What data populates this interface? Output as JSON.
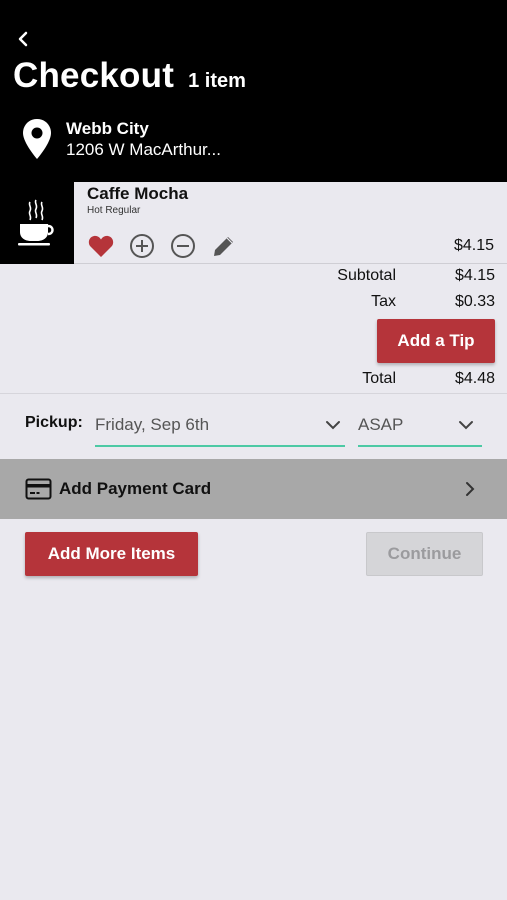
{
  "header": {
    "title": "Checkout",
    "item_count": "1 item",
    "location": {
      "city": "Webb City",
      "address": "1206 W MacArthur..."
    }
  },
  "cart": {
    "items": [
      {
        "name": "Caffe Mocha",
        "modifiers": "Hot Regular",
        "price": "$4.15",
        "icons": [
          "coffee-cup-icon",
          "heart-icon",
          "plus-circle-icon",
          "minus-circle-icon",
          "pencil-icon"
        ]
      }
    ]
  },
  "totals": {
    "subtotal_label": "Subtotal",
    "subtotal_value": "$4.15",
    "tax_label": "Tax",
    "tax_value": "$0.33",
    "tip_button": "Add a Tip",
    "total_label": "Total",
    "total_value": "$4.48"
  },
  "pickup": {
    "label": "Pickup:",
    "date": "Friday, Sep 6th",
    "time": "ASAP"
  },
  "payment": {
    "label": "Add Payment Card",
    "icon": "credit-card-icon"
  },
  "actions": {
    "add_more": "Add More Items",
    "continue": "Continue"
  },
  "colors": {
    "accent": "#b5343a",
    "underline": "#4cc9a4",
    "header_bg": "#000000",
    "background": "#eae9ef"
  }
}
